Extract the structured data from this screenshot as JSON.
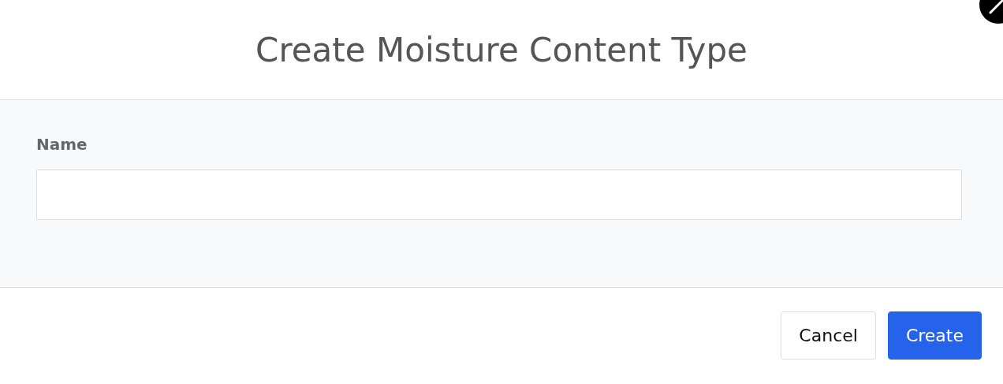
{
  "dialog": {
    "title": "Create Moisture Content Type"
  },
  "fields": [
    {
      "label": "Name"
    }
  ],
  "buttons": [
    {
      "label": "Cancel",
      "kind": "secondary"
    },
    {
      "label": "Create",
      "kind": "primary"
    }
  ]
}
